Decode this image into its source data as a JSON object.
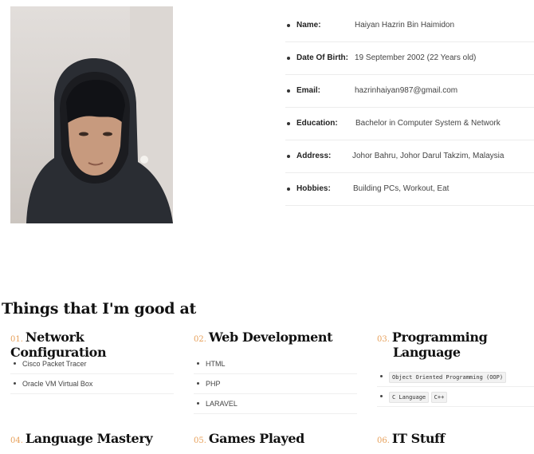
{
  "profile": {
    "fields": [
      {
        "label": "Name:",
        "value": "Haiyan Hazrin Bin Haimidon"
      },
      {
        "label": "Date Of Birth:",
        "value": "19 September 2002 (22 Years old)"
      },
      {
        "label": "Email:",
        "value": "hazrinhaiyan987@gmail.com"
      },
      {
        "label": "Education:",
        "value": "Bachelor in Computer System & Network"
      },
      {
        "label": "Address:",
        "value": "Johor Bahru, Johor Darul Takzim, Malaysia"
      },
      {
        "label": "Hobbies:",
        "value": "Building PCs, Workout, Eat"
      }
    ]
  },
  "skills": {
    "title": "Things that I'm good at",
    "cards": [
      {
        "num": "01.",
        "title": "Network Configuration",
        "items": [
          "Cisco Packet Tracer",
          "Oracle VM Virtual Box"
        ]
      },
      {
        "num": "02.",
        "title": "Web Development",
        "items": [
          "HTML",
          "PHP",
          "LARAVEL"
        ]
      },
      {
        "num": "03.",
        "title_line1": "Programming",
        "title_line2": "Language",
        "items": [
          "Object Oriented Programming (OOP)",
          "C Language",
          "C++"
        ]
      },
      {
        "num": "04.",
        "title": "Language Mastery"
      },
      {
        "num": "05.",
        "title": "Games Played"
      },
      {
        "num": "06.",
        "title": "IT Stuff"
      }
    ]
  },
  "colors": {
    "accent": "#e7a05a",
    "heading": "#111111",
    "text": "#444444"
  }
}
